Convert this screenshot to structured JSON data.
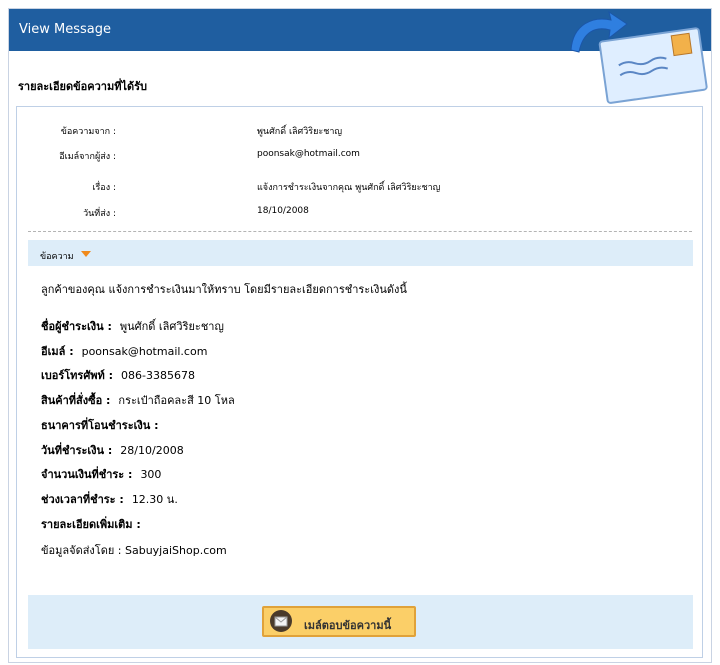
{
  "header": {
    "title": "View Message"
  },
  "page": {
    "heading": "รายละเอียดข้อความที่ได้รับ"
  },
  "meta": [
    {
      "label": "ข้อความจาก :",
      "value": "พูนศักดิ์ เลิศวิริยะชาญ"
    },
    {
      "label": "อีเมล์จากผู้ส่ง :",
      "value": "poonsak@hotmail.com"
    },
    {
      "label": "เรื่อง :",
      "value": "แจ้งการชำระเงินจากคุณ พูนศักดิ์ เลิศวิริยะชาญ"
    },
    {
      "label": "วันที่ส่ง :",
      "value": "18/10/2008"
    }
  ],
  "message": {
    "section_label": "ข้อความ",
    "intro": "ลูกค้าของคุณ แจ้งการชำระเงินมาให้ทราบ โดยมีรายละเอียดการชำระเงินดังนี้",
    "details": [
      {
        "label": "ชื่อผู้ชำระเงิน :",
        "value": "พูนศักดิ์ เลิศวิริยะชาญ"
      },
      {
        "label": "อีเมล์ :",
        "value": "poonsak@hotmail.com"
      },
      {
        "label": "เบอร์โทรศัพท์ :",
        "value": "086-3385678"
      },
      {
        "label": "สินค้าที่สั่งซื้อ :",
        "value": "กระเป๋าถือคละสี 10 โหล"
      },
      {
        "label": "ธนาคารที่โอนชำระเงิน :",
        "value": ""
      },
      {
        "label": "วันที่ชำระเงิน :",
        "value": "28/10/2008"
      },
      {
        "label": "จำนวนเงินที่ชำระ :",
        "value": "300"
      },
      {
        "label": "ช่วงเวลาที่ชำระ :",
        "value": "12.30 น."
      },
      {
        "label": "รายละเอียดเพิ่มเติม :",
        "value": ""
      }
    ],
    "footer_note": "ข้อมูลจัดส่งโดย : SabuyjaiShop.com"
  },
  "actions": {
    "reply_label": "เมล์ตอบข้อความนี้"
  }
}
